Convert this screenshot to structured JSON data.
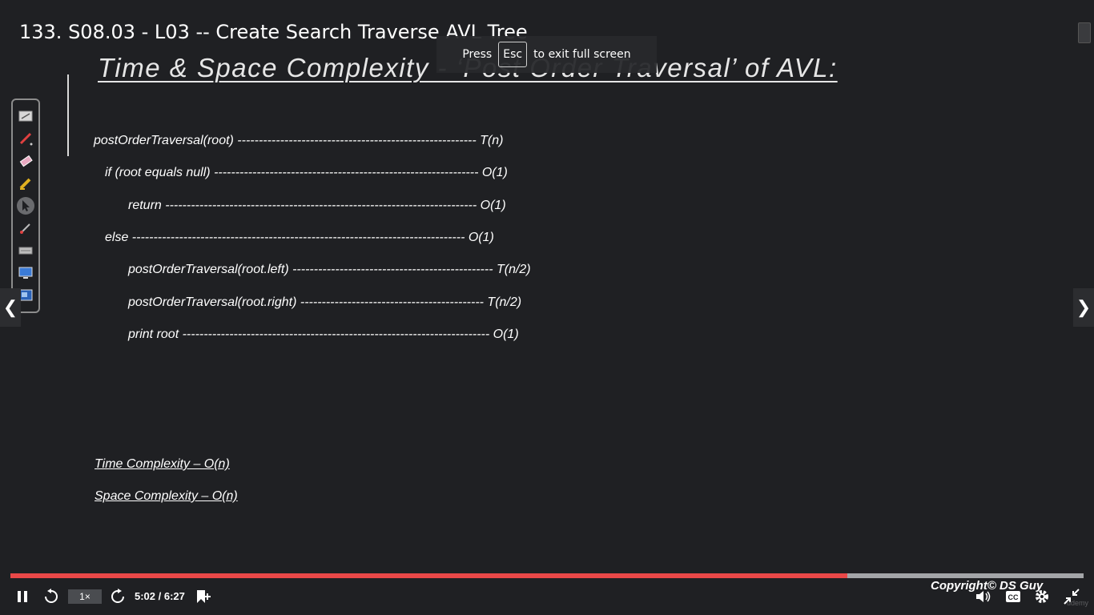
{
  "video": {
    "title": "133. S08.03 - L03 -- Create Search Traverse AVL Tree"
  },
  "fullscreen_notice": {
    "prefix": "Press",
    "key": "Esc",
    "suffix": "to exit full screen"
  },
  "slide": {
    "heading": "Time & Space Complexity - ‘Post Order Traversal’ of AVL:",
    "code_lines": [
      {
        "text": "postOrderTraversal(root) -------------------------------------------------------- T(n)"
      },
      {
        "text": "if (root equals null) -------------------------------------------------------------- O(1)"
      },
      {
        "text": "return ------------------------------------------------------------------------- O(1)"
      },
      {
        "text": "else ------------------------------------------------------------------------------ O(1)"
      },
      {
        "text": "postOrderTraversal(root.left) ----------------------------------------------- T(n/2)"
      },
      {
        "text": "postOrderTraversal(root.right) ------------------------------------------- T(n/2)"
      },
      {
        "text": "print root ------------------------------------------------------------------------ O(1)"
      }
    ],
    "time_complexity": "Time Complexity – O(n)",
    "space_complexity": "Space Complexity – O(n)"
  },
  "annotation_tools": [
    "whiteboard-icon",
    "pen-icon",
    "eraser-icon",
    "highlighter-icon",
    "pointer-icon",
    "brush-icon",
    "keyboard-icon",
    "screen-icon",
    "presenter-icon"
  ],
  "player": {
    "progress": 0.78,
    "speed_label": "1×",
    "current_time": "5:02",
    "duration": "6:27",
    "time_display": "5:02 / 6:27",
    "progress_color": "#e94848",
    "watermark": "Copyright© DS Guy",
    "brand": "udemy"
  }
}
